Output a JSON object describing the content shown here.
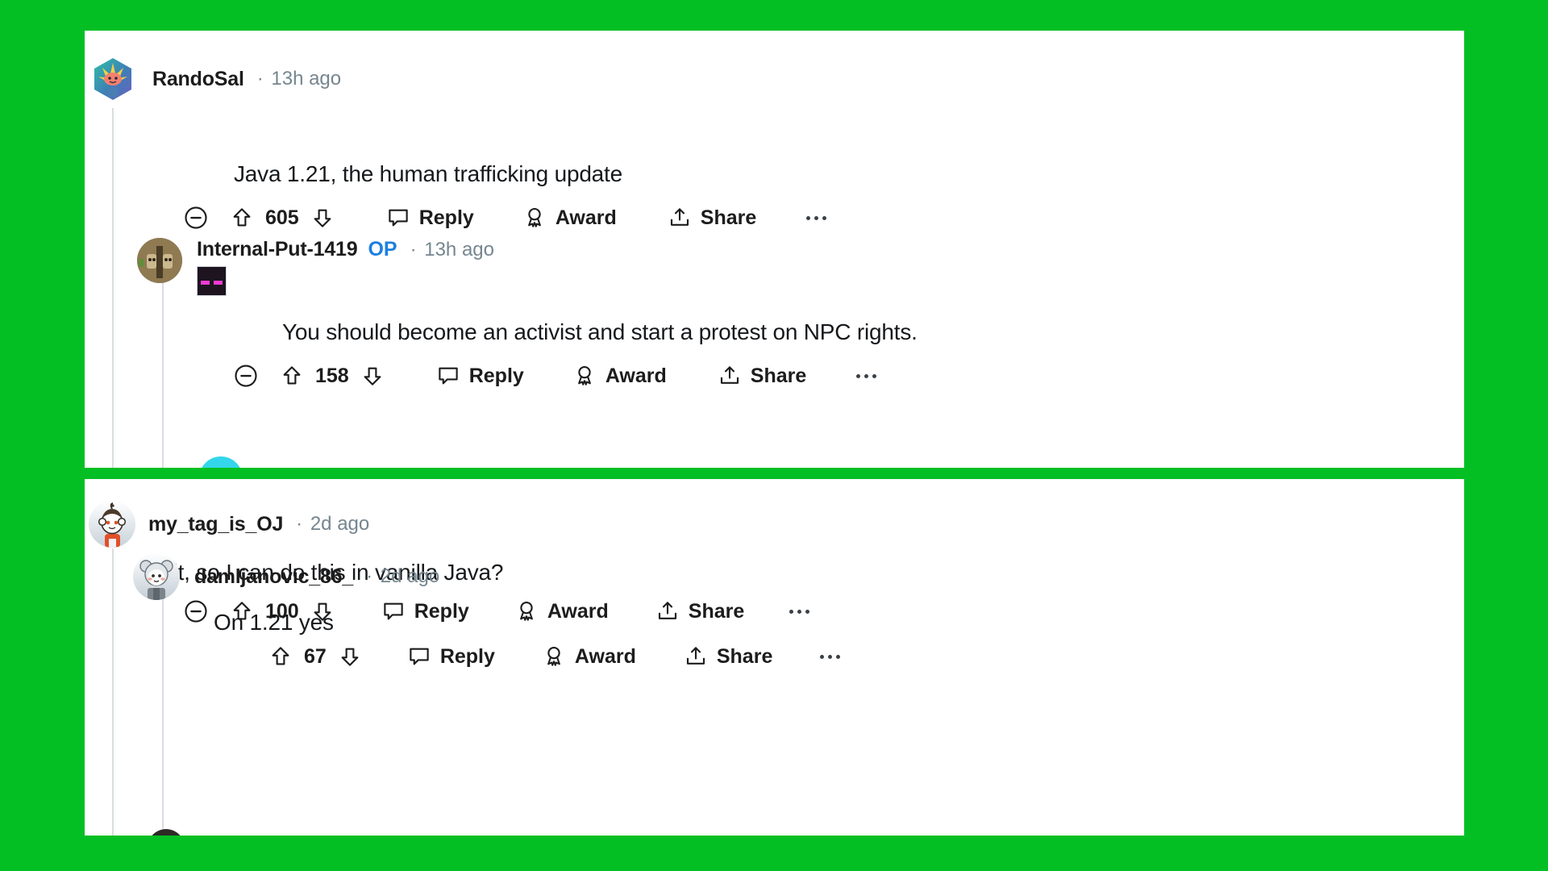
{
  "page": {
    "background_color": "#04bf24",
    "card_background": "#ffffff"
  },
  "colors": {
    "green_background": "#04bf24",
    "op_badge_blue": "#1d7fe0",
    "meta_gray": "#76868f",
    "text_black": "#16191c",
    "thread_line": "#d9dee2",
    "cyan_avatar": "#33d6ea"
  },
  "cards": [
    {
      "id": "card-1",
      "comments": [
        {
          "username": "RandoSal",
          "op": false,
          "op_label": "",
          "timestamp": "13h ago",
          "separator": "·",
          "body": "Java 1.21, the human trafficking update",
          "emoji": "",
          "actions": {
            "collapse": true,
            "score": "605",
            "upvote_icon": "upvote-arrow-icon",
            "downvote_icon": "downvote-arrow-icon",
            "reply_label": "Reply",
            "award_label": "Award",
            "share_label": "Share",
            "more_label": "•••"
          }
        },
        {
          "username": "Internal-Put-1419",
          "op": true,
          "op_label": "OP",
          "timestamp": "13h ago",
          "separator": "·",
          "body": "You should become an activist and start a protest on NPC rights.",
          "emoji": "enderman-face-emoji",
          "actions": {
            "collapse": true,
            "score": "158",
            "upvote_icon": "upvote-arrow-icon",
            "downvote_icon": "downvote-arrow-icon",
            "reply_label": "Reply",
            "award_label": "Award",
            "share_label": "Share",
            "more_label": "•••"
          }
        }
      ]
    },
    {
      "id": "card-2",
      "comments": [
        {
          "username": "my_tag_is_OJ",
          "op": false,
          "op_label": "",
          "timestamp": "2d ago",
          "separator": "·",
          "body": "Wait, so I can do this in vanilla Java?",
          "emoji": "",
          "actions": {
            "collapse": true,
            "score": "100",
            "upvote_icon": "upvote-arrow-icon",
            "downvote_icon": "downvote-arrow-icon",
            "reply_label": "Reply",
            "award_label": "Award",
            "share_label": "Share",
            "more_label": "•••"
          }
        },
        {
          "username": "damljanovic_86_",
          "op": false,
          "op_label": "",
          "timestamp": "2d ago",
          "separator": "·",
          "body": "On 1.21 yes",
          "emoji": "",
          "actions": {
            "collapse": false,
            "score": "67",
            "upvote_icon": "upvote-arrow-icon",
            "downvote_icon": "downvote-arrow-icon",
            "reply_label": "Reply",
            "award_label": "Award",
            "share_label": "Share",
            "more_label": "•••"
          }
        }
      ]
    }
  ]
}
